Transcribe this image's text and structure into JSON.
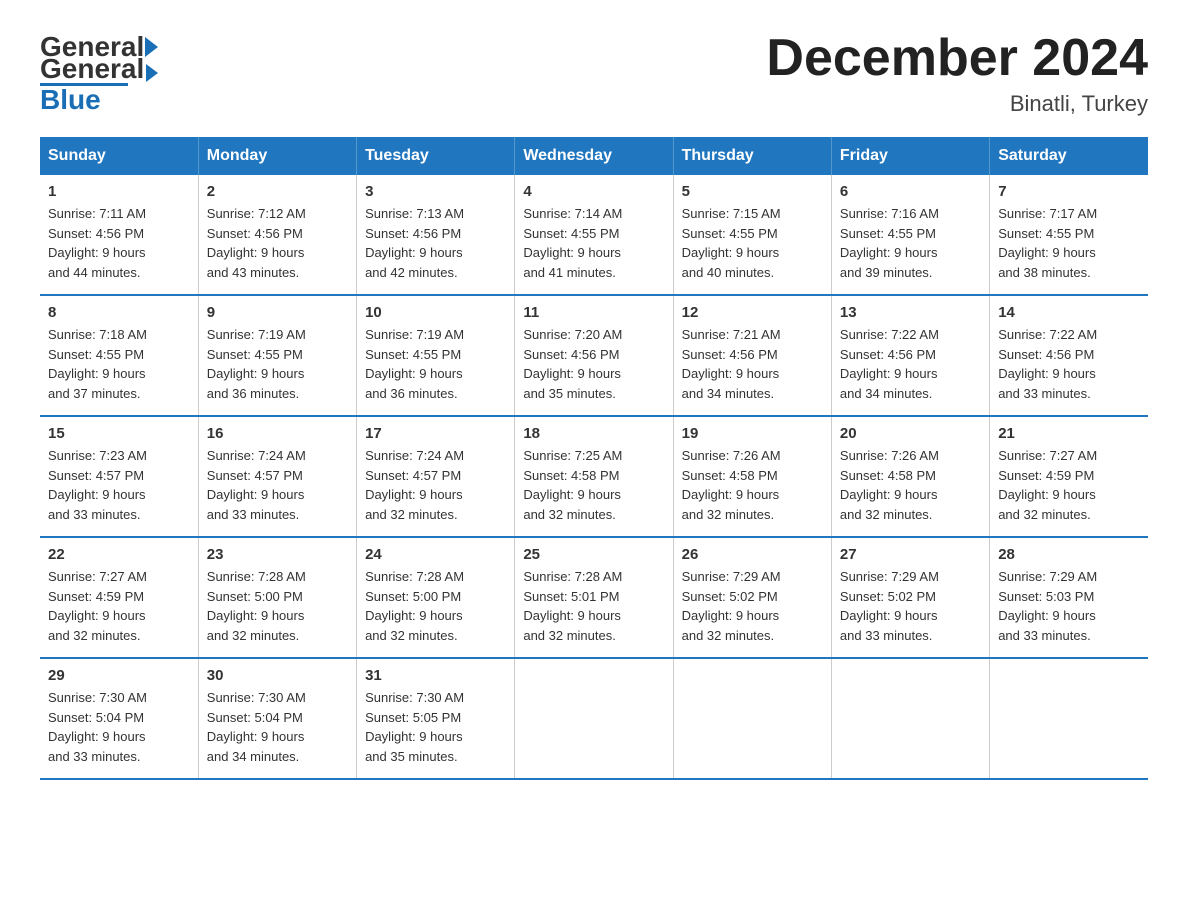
{
  "logo": {
    "general": "General",
    "blue": "Blue"
  },
  "title": "December 2024",
  "subtitle": "Binatli, Turkey",
  "days_of_week": [
    "Sunday",
    "Monday",
    "Tuesday",
    "Wednesday",
    "Thursday",
    "Friday",
    "Saturday"
  ],
  "weeks": [
    [
      {
        "day": "1",
        "sunrise": "7:11 AM",
        "sunset": "4:56 PM",
        "daylight": "9 hours and 44 minutes."
      },
      {
        "day": "2",
        "sunrise": "7:12 AM",
        "sunset": "4:56 PM",
        "daylight": "9 hours and 43 minutes."
      },
      {
        "day": "3",
        "sunrise": "7:13 AM",
        "sunset": "4:56 PM",
        "daylight": "9 hours and 42 minutes."
      },
      {
        "day": "4",
        "sunrise": "7:14 AM",
        "sunset": "4:55 PM",
        "daylight": "9 hours and 41 minutes."
      },
      {
        "day": "5",
        "sunrise": "7:15 AM",
        "sunset": "4:55 PM",
        "daylight": "9 hours and 40 minutes."
      },
      {
        "day": "6",
        "sunrise": "7:16 AM",
        "sunset": "4:55 PM",
        "daylight": "9 hours and 39 minutes."
      },
      {
        "day": "7",
        "sunrise": "7:17 AM",
        "sunset": "4:55 PM",
        "daylight": "9 hours and 38 minutes."
      }
    ],
    [
      {
        "day": "8",
        "sunrise": "7:18 AM",
        "sunset": "4:55 PM",
        "daylight": "9 hours and 37 minutes."
      },
      {
        "day": "9",
        "sunrise": "7:19 AM",
        "sunset": "4:55 PM",
        "daylight": "9 hours and 36 minutes."
      },
      {
        "day": "10",
        "sunrise": "7:19 AM",
        "sunset": "4:55 PM",
        "daylight": "9 hours and 36 minutes."
      },
      {
        "day": "11",
        "sunrise": "7:20 AM",
        "sunset": "4:56 PM",
        "daylight": "9 hours and 35 minutes."
      },
      {
        "day": "12",
        "sunrise": "7:21 AM",
        "sunset": "4:56 PM",
        "daylight": "9 hours and 34 minutes."
      },
      {
        "day": "13",
        "sunrise": "7:22 AM",
        "sunset": "4:56 PM",
        "daylight": "9 hours and 34 minutes."
      },
      {
        "day": "14",
        "sunrise": "7:22 AM",
        "sunset": "4:56 PM",
        "daylight": "9 hours and 33 minutes."
      }
    ],
    [
      {
        "day": "15",
        "sunrise": "7:23 AM",
        "sunset": "4:57 PM",
        "daylight": "9 hours and 33 minutes."
      },
      {
        "day": "16",
        "sunrise": "7:24 AM",
        "sunset": "4:57 PM",
        "daylight": "9 hours and 33 minutes."
      },
      {
        "day": "17",
        "sunrise": "7:24 AM",
        "sunset": "4:57 PM",
        "daylight": "9 hours and 32 minutes."
      },
      {
        "day": "18",
        "sunrise": "7:25 AM",
        "sunset": "4:58 PM",
        "daylight": "9 hours and 32 minutes."
      },
      {
        "day": "19",
        "sunrise": "7:26 AM",
        "sunset": "4:58 PM",
        "daylight": "9 hours and 32 minutes."
      },
      {
        "day": "20",
        "sunrise": "7:26 AM",
        "sunset": "4:58 PM",
        "daylight": "9 hours and 32 minutes."
      },
      {
        "day": "21",
        "sunrise": "7:27 AM",
        "sunset": "4:59 PM",
        "daylight": "9 hours and 32 minutes."
      }
    ],
    [
      {
        "day": "22",
        "sunrise": "7:27 AM",
        "sunset": "4:59 PM",
        "daylight": "9 hours and 32 minutes."
      },
      {
        "day": "23",
        "sunrise": "7:28 AM",
        "sunset": "5:00 PM",
        "daylight": "9 hours and 32 minutes."
      },
      {
        "day": "24",
        "sunrise": "7:28 AM",
        "sunset": "5:00 PM",
        "daylight": "9 hours and 32 minutes."
      },
      {
        "day": "25",
        "sunrise": "7:28 AM",
        "sunset": "5:01 PM",
        "daylight": "9 hours and 32 minutes."
      },
      {
        "day": "26",
        "sunrise": "7:29 AM",
        "sunset": "5:02 PM",
        "daylight": "9 hours and 32 minutes."
      },
      {
        "day": "27",
        "sunrise": "7:29 AM",
        "sunset": "5:02 PM",
        "daylight": "9 hours and 33 minutes."
      },
      {
        "day": "28",
        "sunrise": "7:29 AM",
        "sunset": "5:03 PM",
        "daylight": "9 hours and 33 minutes."
      }
    ],
    [
      {
        "day": "29",
        "sunrise": "7:30 AM",
        "sunset": "5:04 PM",
        "daylight": "9 hours and 33 minutes."
      },
      {
        "day": "30",
        "sunrise": "7:30 AM",
        "sunset": "5:04 PM",
        "daylight": "9 hours and 34 minutes."
      },
      {
        "day": "31",
        "sunrise": "7:30 AM",
        "sunset": "5:05 PM",
        "daylight": "9 hours and 35 minutes."
      },
      null,
      null,
      null,
      null
    ]
  ],
  "labels": {
    "sunrise": "Sunrise: ",
    "sunset": "Sunset: ",
    "daylight": "Daylight: "
  }
}
